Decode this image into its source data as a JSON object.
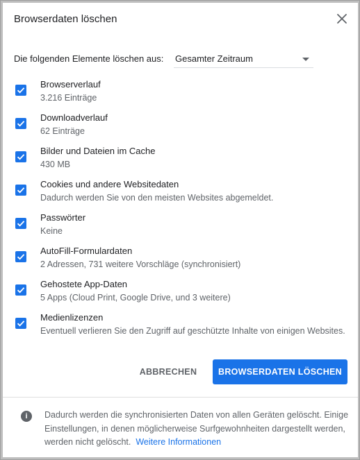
{
  "dialog": {
    "title": "Browserdaten löschen",
    "close_icon": "close-icon"
  },
  "time_range": {
    "label": "Die folgenden Elemente löschen aus:",
    "selected": "Gesamter Zeitraum"
  },
  "items": [
    {
      "title": "Browserverlauf",
      "subtitle": "3.216 Einträge",
      "checked": true
    },
    {
      "title": "Downloadverlauf",
      "subtitle": "62 Einträge",
      "checked": true
    },
    {
      "title": "Bilder und Dateien im Cache",
      "subtitle": "430 MB",
      "checked": true
    },
    {
      "title": "Cookies und andere Websitedaten",
      "subtitle": "Dadurch werden Sie von den meisten Websites abgemeldet.",
      "checked": true
    },
    {
      "title": "Passwörter",
      "subtitle": "Keine",
      "checked": true
    },
    {
      "title": "AutoFill-Formulardaten",
      "subtitle": "2 Adressen, 731 weitere Vorschläge (synchronisiert)",
      "checked": true
    },
    {
      "title": "Gehostete App-Daten",
      "subtitle": "5 Apps (Cloud Print, Google Drive, und 3 weitere)",
      "checked": true
    },
    {
      "title": "Medienlizenzen",
      "subtitle": "Eventuell verlieren Sie den Zugriff auf geschützte Inhalte von einigen Websites.",
      "checked": true
    }
  ],
  "buttons": {
    "cancel": "ABBRECHEN",
    "clear": "BROWSERDATEN LÖSCHEN"
  },
  "footer": {
    "info_icon": "info-icon",
    "text": "Dadurch werden die synchronisierten Daten von allen Geräten gelöscht. Einige Einstellungen, in denen möglicherweise Surfgewohnheiten dargestellt werden, werden nicht gelöscht.",
    "link": "Weitere Informationen"
  },
  "colors": {
    "accent": "#1a73e8",
    "text_primary": "#202124",
    "text_secondary": "#5f6368"
  }
}
